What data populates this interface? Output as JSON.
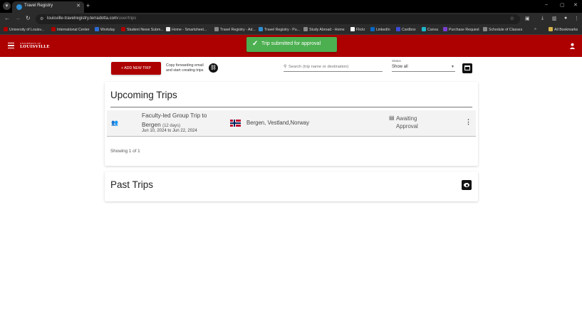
{
  "browser": {
    "tab_title": "Travel Registry",
    "tab_close": "✕",
    "new_tab": "+",
    "window_controls": [
      "–",
      "▢",
      "✕"
    ],
    "url_host": "louisville-travelregistry.terradotta.com",
    "url_path": "/user/trips",
    "bookmarks": [
      {
        "label": "University of Louisv...",
        "color": "#ad0000"
      },
      {
        "label": "International Center",
        "color": "#ad0000"
      },
      {
        "label": "Workday",
        "color": "#2d6bd5"
      },
      {
        "label": "Student News Subm...",
        "color": "#ad0000"
      },
      {
        "label": "Home - Smartsheet...",
        "color": "#eaeaea"
      },
      {
        "label": "Travel Registry - Ad...",
        "color": "#888888"
      },
      {
        "label": "Travel Registry - Pu...",
        "color": "#2d8fd5"
      },
      {
        "label": "Study Abroad - Home",
        "color": "#888888"
      },
      {
        "label": "Flickr",
        "color": "#ffffff"
      },
      {
        "label": "LinkedIn",
        "color": "#0a66c2"
      },
      {
        "label": "Cardbox",
        "color": "#3b4bd6"
      },
      {
        "label": "Canva",
        "color": "#1fb6c9"
      },
      {
        "label": "Purchase Request",
        "color": "#7a3fd0"
      },
      {
        "label": "Schedule of Classes",
        "color": "#888888"
      }
    ],
    "bookmarks_more": "»",
    "all_bookmarks": "All Bookmarks"
  },
  "header": {
    "logo_top": "UNIVERSITY OF",
    "logo_main": "LOUISVILLE",
    "brand_color": "#ad0000"
  },
  "toast": {
    "message": "Trip submitted for approval",
    "color": "#4caf50"
  },
  "toolbar": {
    "add_trip_label": "+ ADD NEW TRIP",
    "forward_email_text": "Copy forwarding email and start creating trips",
    "search_placeholder": "Search (trip name or destination)",
    "status_label": "Status",
    "status_value": "Show all"
  },
  "upcoming": {
    "title": "Upcoming Trips",
    "trips": [
      {
        "title": "Faculty-led Group Trip to Bergen",
        "days": "(12 days)",
        "dates": "Jun 10, 2024 to Jun 22, 2024",
        "location": "Bergen, Vestland,Norway",
        "status": "Awaiting Approval"
      }
    ],
    "showing": "Showing 1 of 1"
  },
  "past": {
    "title": "Past Trips"
  }
}
